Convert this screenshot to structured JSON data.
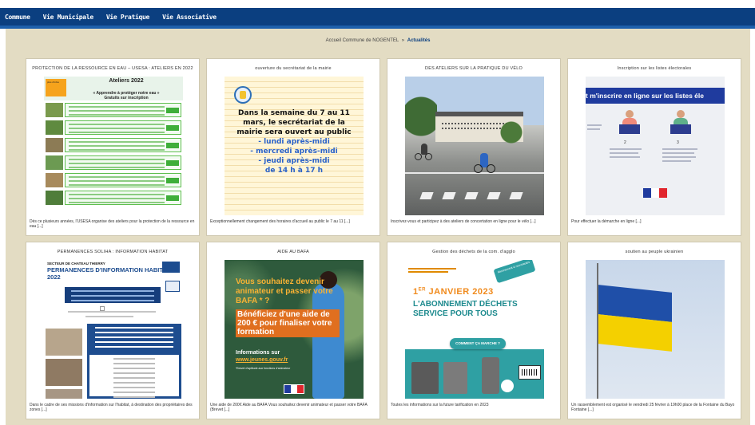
{
  "nav": {
    "items": [
      "Commune",
      "Vie Municipale",
      "Vie Pratique",
      "Vie Associative"
    ]
  },
  "breadcrumb": {
    "home": "Accueil Commune de NOGENTEL",
    "separator": "»",
    "current": "Actualités"
  },
  "colors": {
    "nav_bg": "#0b3f80",
    "page_bg": "#e3dcc3",
    "accent_green": "#3fae3a",
    "accent_orange": "#f08a1c",
    "ukraine_blue": "#1f4fa8",
    "ukraine_yellow": "#f4d000"
  },
  "cards": [
    {
      "title": "PROTECTION DE LA RESSOURCE EN EAU – USESA : ATELIERS EN 2022",
      "text": "Dès ce plusieurs années, l'USESA organise des ateliers pour la protection de la ressource en eau [...]",
      "image": {
        "heading": "Ateliers 2022",
        "sub1": "« Apprendre à protéger notre eau »",
        "sub2": "Gratuits sur inscription",
        "side_note": "plus d'infos"
      }
    },
    {
      "title": "ouverture du secrétariat de la mairie",
      "text": "Exceptionnellement changement des horaires d'accueil au public le 7 au 11 [...]",
      "image": {
        "line1": "Dans la semaine du 7 au 11",
        "line2": "mars, le  secrétariat de la",
        "line3": "mairie sera ouvert au public",
        "line4": "- lundi après-midi",
        "line5": "- mercredi après-midi",
        "line6": "- jeudi après-midi",
        "line7": "de 14 h à 17 h"
      }
    },
    {
      "title": "DES ATELIERS SUR LA PRATIQUE DU VÉLO",
      "text": "Inscrivez-vous et participez à des ateliers de concertation en ligne pour le vélo [...]",
      "image": {}
    },
    {
      "title": "Inscription sur les listes électorales",
      "text": "Pour effectuer la démarche en ligne [...]",
      "image": {
        "banner": "t m'inscrire en ligne sur les listes éle",
        "step2": "2",
        "step3": "3"
      }
    },
    {
      "title": "PERMANENCES SOLIHA : INFORMATION HABITAT",
      "text": "Dans le cadre de ses missions d'information sur l'habitat, à destination des propriétaires des zones [...]",
      "image": {
        "t1": "SECTEUR DE CHATEAU THIERRY",
        "t2": "PERMANENCES D'INFORMATION HABITAT",
        "t3": "2022"
      }
    },
    {
      "title": "AIDE AU BAFA",
      "text": "Une aide de 200€ Aide au BAFA Vous souhaitez devenir animateur et passer votre BAFA (Brevet [...]",
      "image": {
        "o1": "Vous souhaitez devenir animateur et passer votre BAFA * ?",
        "o2": "Bénéficiez d'une aide de 200 € pour finaliser votre formation",
        "o3": "Informations sur",
        "o3_link": "www.jeunes.gouv.fr",
        "o4": "*Brevet d'aptitude aux fonctions d'animateur"
      }
    },
    {
      "title": "Gestion des déchets de la com. d'agglo",
      "text": "Toutes les informations sur la future tarification en 2023",
      "image": {
        "date_main": "1",
        "date_sup": "ER",
        "date_rest": " JANVIER 2023",
        "line1": "L'ABONNEMENT DÉCHETS",
        "line2": "SERVICE POUR TOUS",
        "pill": "COMMENT ÇA MARCHE ?",
        "sticker": "Abonnement & nouveautés"
      }
    },
    {
      "title": "soutien au peuple ukrainien",
      "text": "Un rassemblement est organisé le vendredi 25 février à 19h00 place de la Fontaine du Bayo Fontaine [...]",
      "image": {}
    }
  ]
}
